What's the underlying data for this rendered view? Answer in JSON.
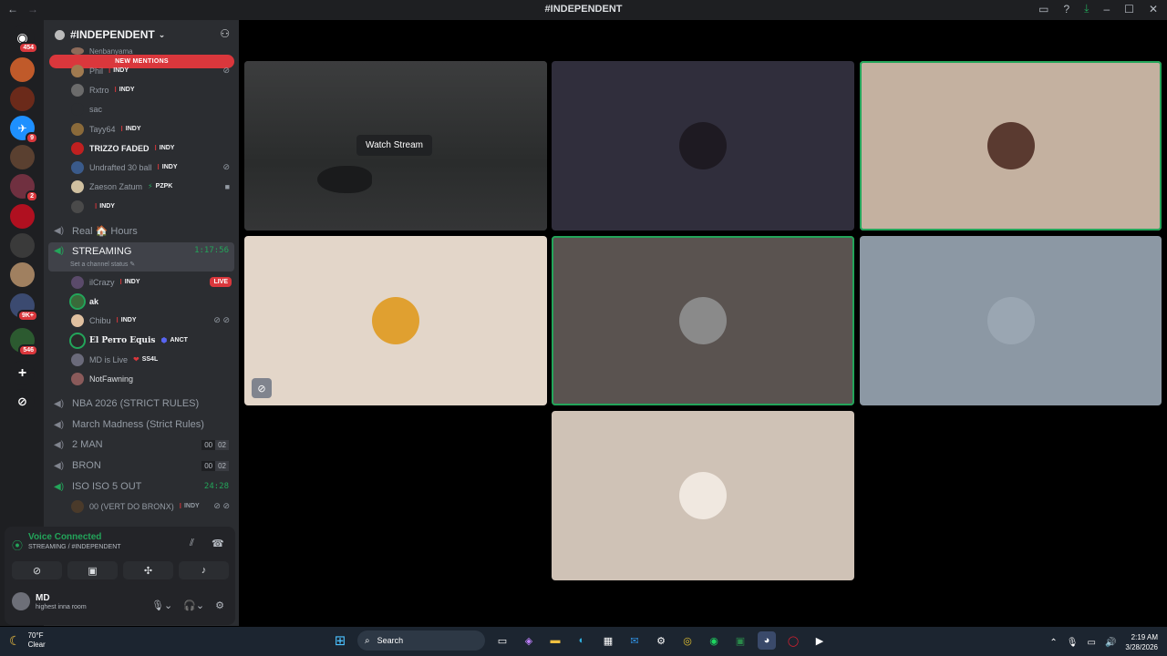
{
  "window": {
    "title": "#INDEPENDENT",
    "back": "←",
    "forward": "→"
  },
  "guilds": {
    "home_badge": "454",
    "badges": [
      "9",
      "2",
      "9K+",
      "546"
    ],
    "add": "+",
    "explore": "⊘"
  },
  "sidebar": {
    "server_name": "#INDEPENDENT",
    "new_mentions": "NEW MENTIONS",
    "top_cut": "Nenbanyama",
    "members_top": [
      {
        "name": "Phil",
        "tag": "INDY",
        "bold": false
      },
      {
        "name": "Rxtro",
        "tag": "INDY",
        "bold": false
      },
      {
        "name": "sac",
        "tag": "",
        "bold": false
      },
      {
        "name": "Tayy64",
        "tag": "INDY",
        "bold": false
      },
      {
        "name": "TRIZZO FADED",
        "tag": "INDY",
        "bold": true
      },
      {
        "name": "Undrafted 30 ball",
        "tag": "INDY",
        "bold": false
      },
      {
        "name": "Zaeson Zatum",
        "tag": "PZPK",
        "bold": false
      },
      {
        "name": "",
        "tag": "INDY",
        "bold": false
      }
    ],
    "channel_real": "Real 🏠 Hours",
    "channel_streaming": "STREAMING",
    "streaming_time": "1:17:56",
    "streaming_status": "Set a channel status",
    "members_streaming": [
      {
        "name": "ilCrazy",
        "tag": "INDY",
        "bold": false
      },
      {
        "name": "ak",
        "tag": "",
        "bold": true
      },
      {
        "name": "Chibu",
        "tag": "INDY",
        "bold": false
      },
      {
        "name": "El Perro Equis",
        "tag": "ANCT",
        "bold": true
      },
      {
        "name": "MD is Live",
        "tag": "SS4L",
        "bold": false
      },
      {
        "name": "NotFawning",
        "tag": "",
        "bold": false
      }
    ],
    "live_label": "LIVE",
    "channel_nba": "NBA 2026 (STRICT RULES)",
    "channel_march": "March Madness (Strict Rules)",
    "channel_2man": "2 MAN",
    "c2man_a": "00",
    "c2man_b": "02",
    "channel_bron": "BRON",
    "cbron_a": "00",
    "cbron_b": "02",
    "channel_iso": "ISO ISO 5 OUT",
    "iso_time": "24:28",
    "iso_member": "00 (VERT DO BRONX)",
    "iso_tag": "INDY"
  },
  "voice": {
    "status": "Voice Connected",
    "channel": "STREAMING / #INDEPENDENT"
  },
  "user": {
    "name": "MD",
    "status": "highest inna room"
  },
  "stage": {
    "watch_stream": "Watch Stream"
  },
  "taskbar": {
    "temp": "70°F",
    "condition": "Clear",
    "search": "Search",
    "time": "2:19 AM",
    "date": "3/28/2026"
  },
  "colors": {
    "accent_green": "#23a55a",
    "mention_red": "#da373c",
    "sidebar": "#2b2d31"
  }
}
